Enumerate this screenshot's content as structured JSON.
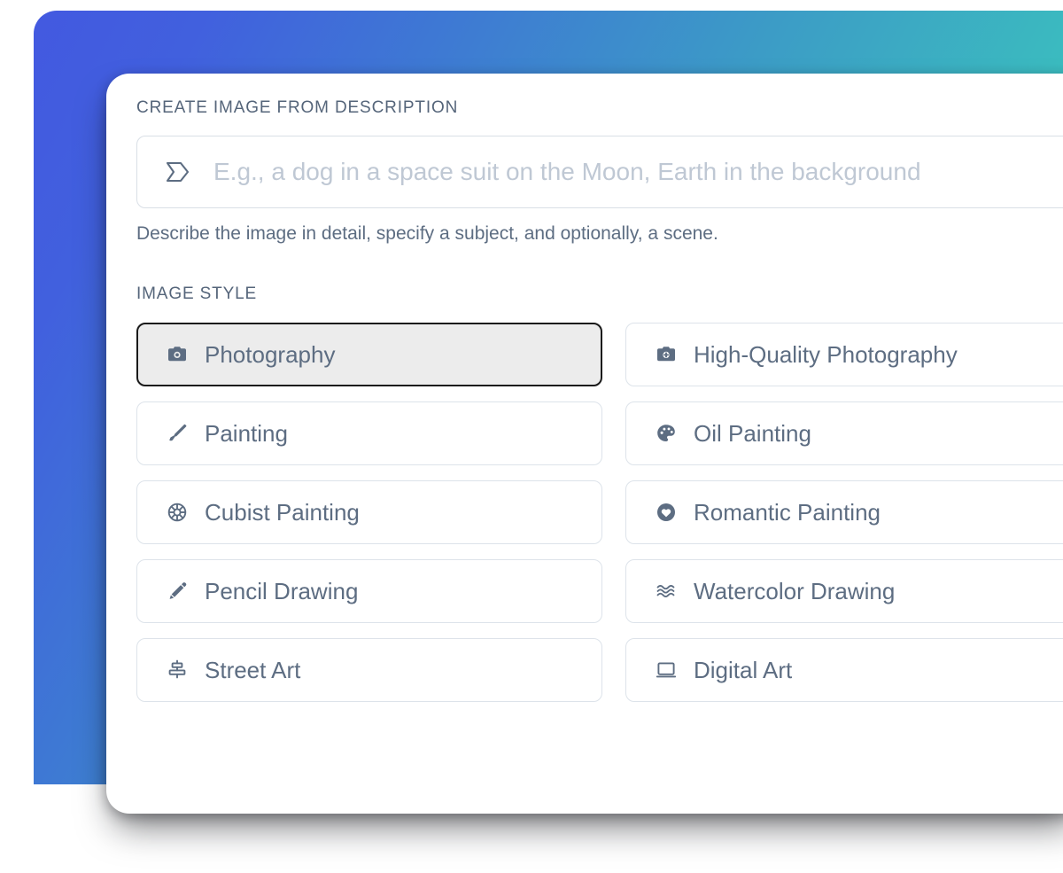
{
  "theme": {
    "gradient_start": "#4359E0",
    "gradient_end": "#3EC7C6",
    "text_color": "#5D6D82",
    "border_color": "#DDE3EA",
    "selected_fill": "#ECECEC",
    "selected_border": "#1A1A1A",
    "placeholder_color": "#BFC8D4"
  },
  "panel": {
    "create_section_label": "CREATE IMAGE FROM DESCRIPTION",
    "prompt": {
      "icon": "arrow-banner-icon",
      "placeholder": "E.g., a dog in a space suit on the Moon, Earth in the background",
      "value": ""
    },
    "prompt_hint": "Describe the image in detail, specify a subject, and optionally, a scene.",
    "style_section_label": "IMAGE STYLE",
    "styles": [
      {
        "label": "Photography",
        "icon": "camera-icon",
        "selected": true
      },
      {
        "label": "High-Quality Photography",
        "icon": "camera-plus-icon",
        "selected": false
      },
      {
        "label": "Painting",
        "icon": "paintbrush-icon",
        "selected": false
      },
      {
        "label": "Oil Painting",
        "icon": "palette-icon",
        "selected": false
      },
      {
        "label": "Cubist Painting",
        "icon": "spoked-wheel-icon",
        "selected": false
      },
      {
        "label": "Romantic Painting",
        "icon": "heart-circle-icon",
        "selected": false
      },
      {
        "label": "Pencil Drawing",
        "icon": "pencil-icon",
        "selected": false
      },
      {
        "label": "Watercolor Drawing",
        "icon": "waves-icon",
        "selected": false
      },
      {
        "label": "Street Art",
        "icon": "spray-stack-icon",
        "selected": false
      },
      {
        "label": "Digital Art",
        "icon": "monitor-icon",
        "selected": false
      }
    ]
  }
}
